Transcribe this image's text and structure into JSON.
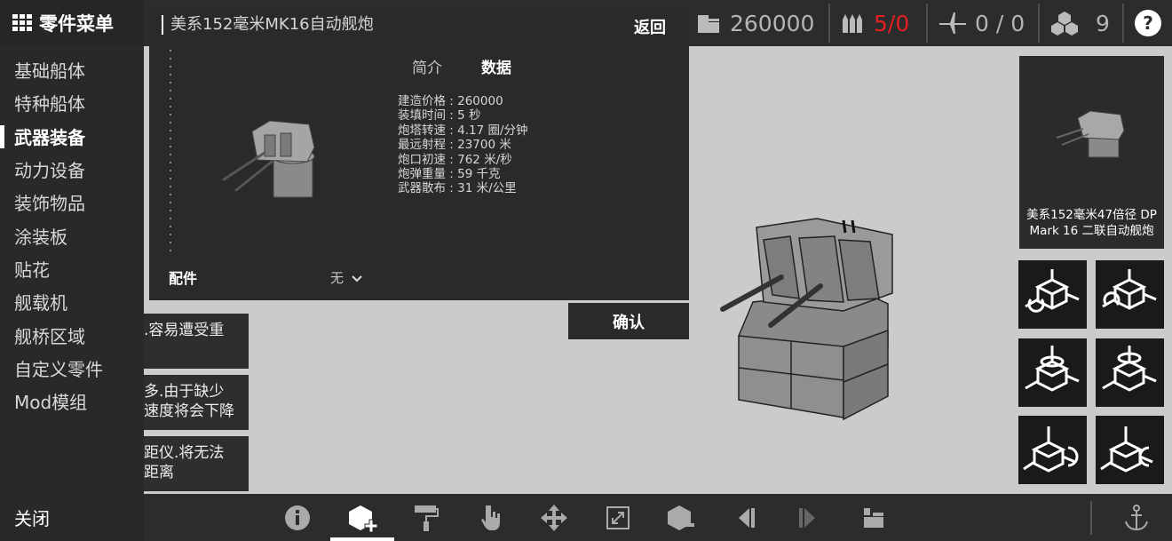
{
  "topbar": {
    "money": "260000",
    "ammo": "5/0",
    "aircraft": "0 / 0",
    "parts": "9",
    "help": "?"
  },
  "menu": {
    "title": "零件菜单",
    "items": [
      "基础船体",
      "特种船体",
      "武器装备",
      "动力设备",
      "装饰物品",
      "涂装板",
      "贴花",
      "舰载机",
      "舰桥区域",
      "自定义零件",
      "Mod模组"
    ],
    "close": "关闭"
  },
  "descriptions": [
    ".容易遭受重",
    "多.由于缺少\n速度将会下降",
    "距仪.将无法\n距离"
  ],
  "detail": {
    "title": "美系152毫米MK16自动舰炮",
    "back": "返回",
    "tabs": [
      "简介",
      "数据"
    ],
    "stats": [
      "建造价格 : 260000",
      "装填时间 : 5 秒",
      "炮塔转速 : 4.17 圈/分钟",
      "最远射程 : 23700 米",
      "炮口初速 : 762 米/秒",
      "炮弹重量 : 59 千克",
      "武器散布 : 31 米/公里"
    ],
    "parts_label": "配件",
    "parts_value": "无",
    "confirm": "确认"
  },
  "part_card": {
    "name": "美系152毫米47倍径 DP Mark 16 二联自动舰炮"
  },
  "colors": {
    "ammo_accent": "#e02020",
    "panel_bg": "#2a2a2a",
    "canvas_bg": "#cbcbcb"
  }
}
